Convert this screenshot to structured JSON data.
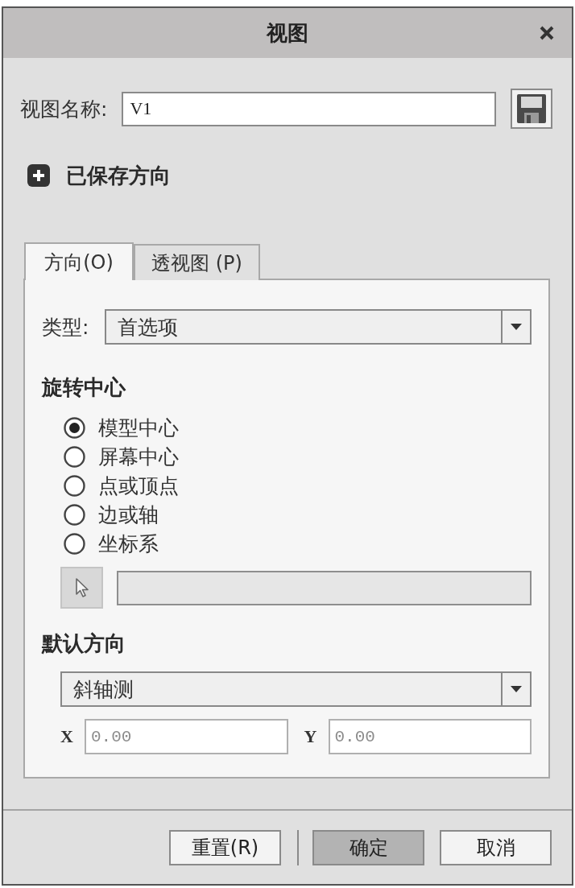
{
  "window": {
    "title": "视图"
  },
  "name_row": {
    "label": "视图名称:",
    "value": "V1"
  },
  "saved_orientations": {
    "label": "已保存方向",
    "expanded": false
  },
  "tabs": [
    {
      "label": "方向(O)",
      "selected": true
    },
    {
      "label": "透视图 (P)",
      "selected": false
    }
  ],
  "type": {
    "label": "类型:",
    "value": "首选项"
  },
  "rotation_center": {
    "heading": "旋转中心",
    "options": [
      {
        "label": "模型中心",
        "selected": true
      },
      {
        "label": "屏幕中心",
        "selected": false
      },
      {
        "label": "点或顶点",
        "selected": false
      },
      {
        "label": "边或轴",
        "selected": false
      },
      {
        "label": "坐标系",
        "selected": false
      }
    ],
    "reference": {
      "disabled": true
    }
  },
  "default_orientation": {
    "heading": "默认方向",
    "value": "斜轴测",
    "x": {
      "label": "X",
      "value": "0.00",
      "disabled": true
    },
    "y": {
      "label": "Y",
      "value": "0.00",
      "disabled": true
    }
  },
  "footer": {
    "secondary": [
      {
        "label": "重置(R)",
        "default": false
      }
    ],
    "primary": [
      {
        "label": "确定",
        "default": true
      },
      {
        "label": "取消",
        "default": false
      }
    ]
  }
}
